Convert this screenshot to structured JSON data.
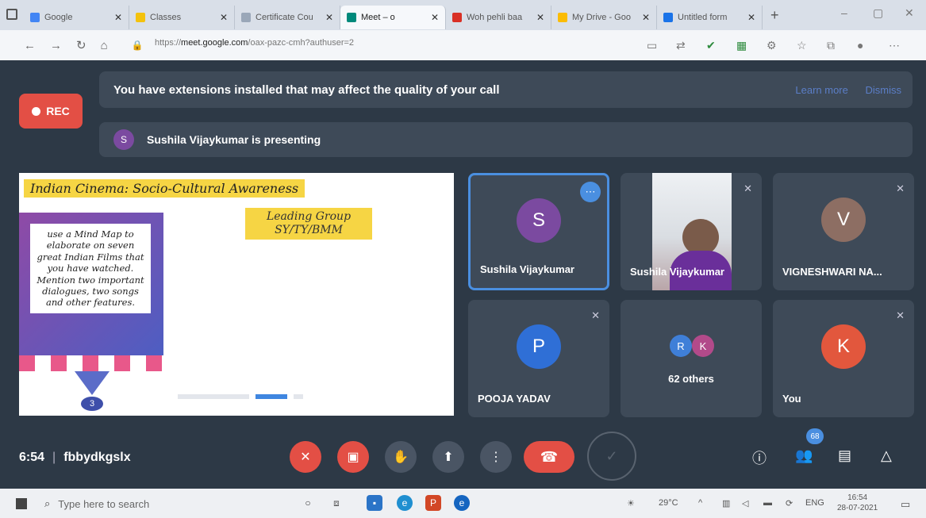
{
  "browser": {
    "tabs": [
      {
        "label": "Google",
        "favicon_color": "#4285f4"
      },
      {
        "label": "Classes",
        "favicon_color": "#f4c20d"
      },
      {
        "label": "Certificate Cou",
        "favicon_color": "#9aa7b8"
      },
      {
        "label": "Meet – o",
        "favicon_color": "#00897b",
        "active": true
      },
      {
        "label": "Woh pehli baa",
        "favicon_color": "#d93025"
      },
      {
        "label": "My Drive - Goo",
        "favicon_color": "#fbbc04"
      },
      {
        "label": "Untitled form",
        "favicon_color": "#1a73e8"
      }
    ],
    "url_prefix": "https://",
    "url_host": "meet.google.com",
    "url_path": "/oax-pazc-cmh?authuser=2"
  },
  "meet": {
    "extension_warning": "You have extensions installed that may affect the quality of your call",
    "learn_more": "Learn more",
    "dismiss": "Dismiss",
    "rec_label": "REC",
    "presenter_initial": "S",
    "presenter_text": "Sushila Vijaykumar is presenting",
    "slide": {
      "title": "Indian Cinema: Socio-Cultural Awareness",
      "subtitle": "Leading Group SY/TY/BMM",
      "body": "use a Mind Map to elaborate on seven great Indian Films that you have watched. Mention two important dialogues, two songs and other features.",
      "number": "3"
    },
    "tiles": [
      {
        "name": "Sushila Vijaykumar",
        "initial": "S",
        "color": "#7b4aa0"
      },
      {
        "name": "Sushila Vijaykumar"
      },
      {
        "name": "VIGNESHWARI NA...",
        "initial": "V",
        "color": "#8d6e63"
      },
      {
        "name": "POOJA YADAV",
        "initial": "P",
        "color": "#2f6fd6"
      },
      {
        "others_label": "62 others",
        "initials": [
          "R",
          "K"
        ],
        "colors": [
          "#3f7fd8",
          "#b24a8a"
        ]
      },
      {
        "name": "You",
        "initial": "K",
        "color": "#e2573d"
      }
    ],
    "time": "6:54",
    "meeting_code": "fbbydkgslx",
    "participant_count": "68"
  },
  "taskbar": {
    "search_placeholder": "Type here to search",
    "temperature": "29°C",
    "lang": "ENG",
    "time": "16:54",
    "date": "28-07-2021"
  }
}
